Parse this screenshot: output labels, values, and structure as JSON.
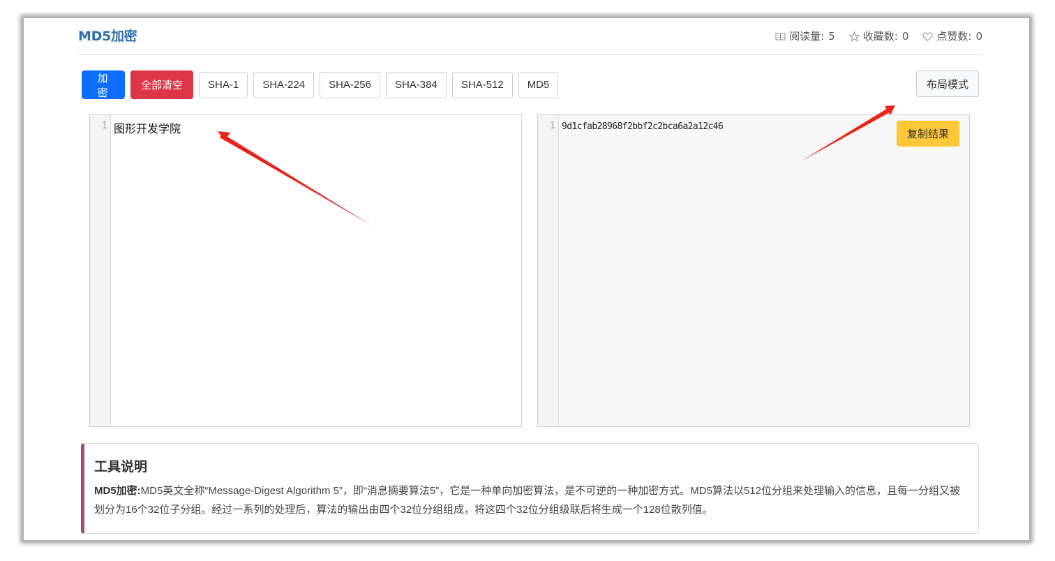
{
  "header": {
    "title": "MD5加密",
    "stats": [
      {
        "icon": "book-icon",
        "label": "阅读量:",
        "value": "5"
      },
      {
        "icon": "star-icon",
        "label": "收藏数:",
        "value": "0"
      },
      {
        "icon": "heart-icon",
        "label": "点赞数:",
        "value": "0"
      }
    ]
  },
  "toolbar": {
    "encrypt_label": "加 密",
    "clear_label": "全部清空",
    "algorithms": [
      "SHA-1",
      "SHA-224",
      "SHA-256",
      "SHA-384",
      "SHA-512",
      "MD5"
    ],
    "layout_label": "布局模式"
  },
  "input_editor": {
    "line_number": "1",
    "text": "图形开发学院"
  },
  "output_editor": {
    "line_number": "1",
    "text": "9d1cfab28968f2bbf2c2bca6a2a12c46",
    "copy_label": "复制结果"
  },
  "description": {
    "title": "工具说明",
    "lead": "MD5加密:",
    "body": "MD5英文全称“Message-Digest Algorithm 5”，即“消息摘要算法5”，它是一种单向加密算法，是不可逆的一种加密方式。MD5算法以512位分组来处理输入的信息，且每一分组又被划分为16个32位子分组。经过一系列的处理后，算法的输出由四个32位分组组成，将这四个32位分组级联后将生成一个128位散列值。"
  },
  "colors": {
    "title": "#2f6fad",
    "primary": "#0d6efd",
    "danger": "#dc3545",
    "warning": "#ffc83a",
    "accent_border": "#9b4a84",
    "annotation_arrow": "#e8231b"
  }
}
